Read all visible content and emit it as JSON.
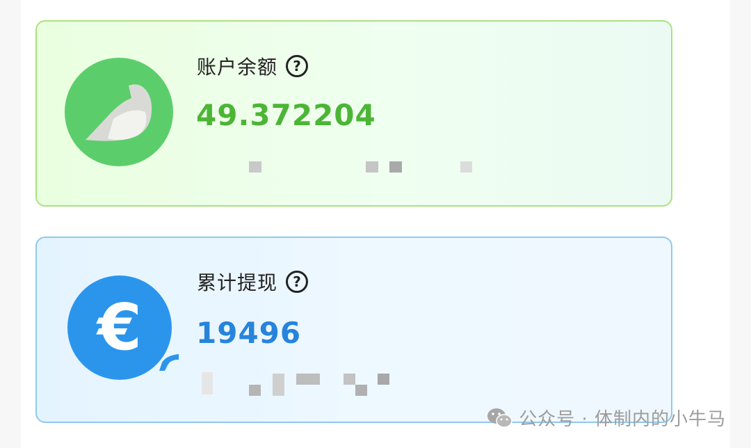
{
  "balance_card": {
    "label": "账户余额",
    "help_symbol": "?",
    "amount": "49.372204",
    "icon": "bird-icon",
    "accent_color": "#4cb536",
    "border_color": "#a9e27e"
  },
  "withdraw_card": {
    "label": "累计提现",
    "help_symbol": "?",
    "amount": "19496",
    "icon_symbol": "€",
    "icon": "euro-icon",
    "accent_color": "#2684dc",
    "border_color": "#8ec9ee"
  },
  "watermark": {
    "icon": "wechat-icon",
    "text": "公众号 · 体制内的小牛马"
  }
}
